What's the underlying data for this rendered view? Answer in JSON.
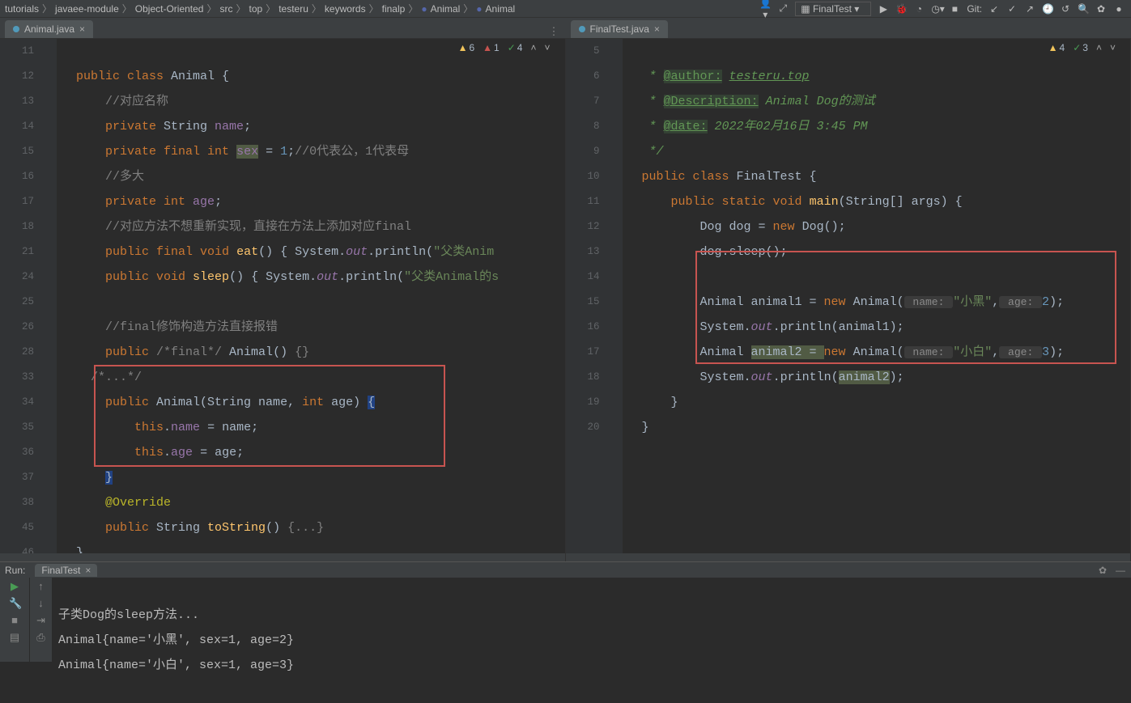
{
  "breadcrumbs": [
    "tutorials",
    "javaee-module",
    "Object-Oriented",
    "src",
    "top",
    "testeru",
    "keywords",
    "finalp",
    "Animal",
    "Animal"
  ],
  "run_config": "FinalTest",
  "git_label": "Git:",
  "tabs": {
    "left": "Animal.java",
    "right": "FinalTest.java"
  },
  "inspections": {
    "left": {
      "warn": "6",
      "err": "1",
      "ok": "4"
    },
    "right": {
      "warn": "4",
      "ok": "3"
    }
  },
  "left_editor": {
    "lines": [
      "11",
      "12",
      "13",
      "14",
      "15",
      "16",
      "17",
      "18",
      "21",
      "24",
      "25",
      "26",
      "28",
      "33",
      "34",
      "35",
      "36",
      "37",
      "38",
      "45",
      "46"
    ],
    "code": {
      "l11": {
        "pre": "public class ",
        "cls": "Animal",
        "post": " {"
      },
      "l12": "//对应名称",
      "l13": {
        "mods": "private ",
        "type": "String ",
        "name": "name",
        "post": ";"
      },
      "l14": {
        "mods": "private final ",
        "type": "int ",
        "name": "sex",
        "eq": " = ",
        "val": "1",
        "post": ";",
        "cmt": "//0代表公，1代表母"
      },
      "l15": "//多大",
      "l16": {
        "mods": "private ",
        "type": "int ",
        "name": "age",
        "post": ";"
      },
      "l17": "//对应方法不想重新实现，直接在方法上添加对应final",
      "l18": {
        "mods": "public final ",
        "ret": "void ",
        "fn": "eat",
        "sig": "() { ",
        "sys": "System",
        "dot1": ".",
        "out": "out",
        "dot2": ".",
        "pr": "println",
        "open": "(",
        "str": "\"父类Anim"
      },
      "l21": {
        "mods": "public ",
        "ret": "void ",
        "fn": "sleep",
        "sig": "() { ",
        "sys": "System",
        "dot1": ".",
        "out": "out",
        "dot2": ".",
        "pr": "println",
        "open": "(",
        "str": "\"父类Animal的s"
      },
      "l25": "//final修饰构造方法直接报错",
      "l26": {
        "mods": "public ",
        "cmt": "/*final*/ ",
        "cls": "Animal",
        "sig": "() ",
        "body": "{}"
      },
      "l28": "/*...*/",
      "l33": {
        "mods": "public ",
        "cls": "Animal",
        "sig": "(String name, ",
        "int": "int ",
        "age": "age) ",
        "br": "{"
      },
      "l34": {
        "this": "this",
        "dot": ".",
        "fld": "name",
        "eq": " = name;"
      },
      "l35": {
        "this": "this",
        "dot": ".",
        "fld": "age",
        "eq": " = age;"
      },
      "l36": "}",
      "l37": "@Override",
      "l38": {
        "mods": "public ",
        "ret": "String ",
        "fn": "toString",
        "sig": "() ",
        "body": "{...}"
      },
      "l45": "}"
    }
  },
  "right_editor": {
    "lines": [
      "5",
      "6",
      "7",
      "8",
      "9",
      "10",
      "11",
      "12",
      "13",
      "14",
      "15",
      "16",
      "17",
      "18",
      "19",
      "20"
    ],
    "code": {
      "l5": {
        "star": " * ",
        "tag": "@author:",
        "sp": " ",
        "val": "testeru.top"
      },
      "l6": {
        "star": " * ",
        "tag": "@Description:",
        "sp": " ",
        "val": "Animal Dog的测试"
      },
      "l7": {
        "star": " * ",
        "tag": "@date:",
        "sp": " ",
        "val": "2022年02月16日 3:45 PM"
      },
      "l8": " */",
      "l9": {
        "mods": "public class ",
        "cls": "FinalTest",
        "post": " {"
      },
      "l10": {
        "mods": "public static ",
        "ret": "void ",
        "fn": "main",
        "sig": "(String[] args) {"
      },
      "l11": {
        "type": "Dog ",
        "var": "dog = ",
        "new": "new ",
        "cls": "Dog",
        "post": "();"
      },
      "l12": "dog.sleep();",
      "l14": {
        "type": "Animal ",
        "var": "animal1 = ",
        "new": "new ",
        "cls": "Animal",
        "open": "(",
        "h1": " name: ",
        "s1": "\"小黑\"",
        "c1": ",",
        "h2": " age: ",
        "n1": "2",
        "post": ");"
      },
      "l15": {
        "sys": "System",
        "dot1": ".",
        "out": "out",
        "dot2": ".",
        "pr": "println",
        "open": "(",
        "var": "animal1",
        "post": ");"
      },
      "l16": {
        "type": "Animal ",
        "var": "animal2 = ",
        "new": "new ",
        "cls": "Animal",
        "open": "(",
        "h1": " name: ",
        "s1": "\"小白\"",
        "c1": ",",
        "h2": " age: ",
        "n1": "3",
        "post": ");"
      },
      "l17": {
        "sys": "System",
        "dot1": ".",
        "out": "out",
        "dot2": ".",
        "pr": "println",
        "open": "(",
        "var": "animal2",
        "post": ");"
      },
      "l18": "}",
      "l19": "}"
    }
  },
  "run_panel": {
    "label": "Run:",
    "tab": "FinalTest",
    "out1": "子类Dog的sleep方法...",
    "out2": "Animal{name='小黑', sex=1, age=2}",
    "out3": "Animal{name='小白', sex=1, age=3}"
  }
}
